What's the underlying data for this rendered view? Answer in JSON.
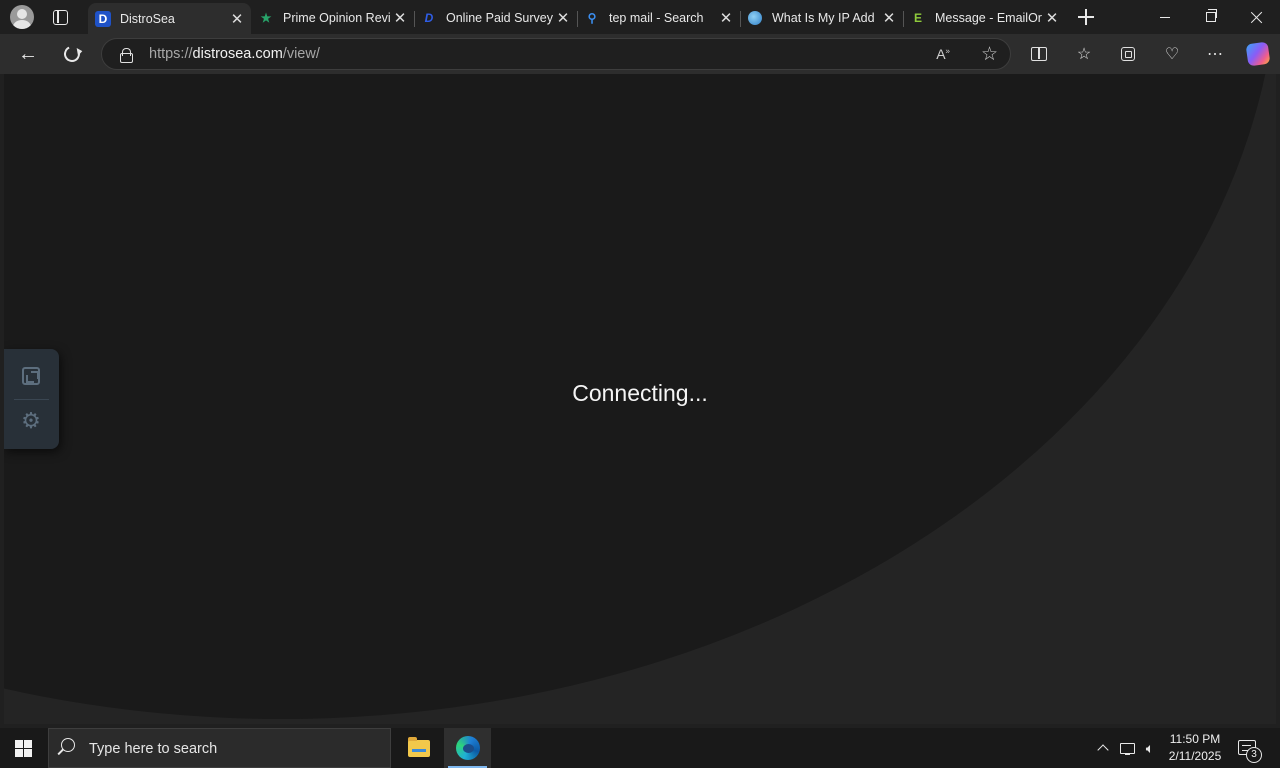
{
  "browser": {
    "tabs": [
      {
        "title": "DistroSea",
        "favicon": "distrosea-d-icon",
        "favicon_text": "D",
        "active": true
      },
      {
        "title": "Prime Opinion Revi",
        "favicon": "star-icon"
      },
      {
        "title": "Online Paid Survey",
        "favicon": "paid-survey-icon"
      },
      {
        "title": "tep mail - Search",
        "favicon": "search-icon"
      },
      {
        "title": "What Is My IP Add",
        "favicon": "globe-icon"
      },
      {
        "title": "Message - EmailOr",
        "favicon": "emailondeck-e-icon",
        "favicon_text": "E"
      }
    ],
    "address": {
      "scheme": "https://",
      "host": "distrosea.com",
      "path": "/view/"
    },
    "accent_color": "#1f52c7"
  },
  "page": {
    "status_text": "Connecting...",
    "side_panel": {
      "icons": [
        "fullscreen-icon",
        "gear-icon"
      ]
    }
  },
  "taskbar": {
    "search_placeholder": "Type here to search",
    "apps": [
      "file-explorer-icon",
      "edge-icon"
    ],
    "clock_time": "11:50 PM",
    "clock_date": "2/11/2025",
    "notification_count": "3"
  }
}
